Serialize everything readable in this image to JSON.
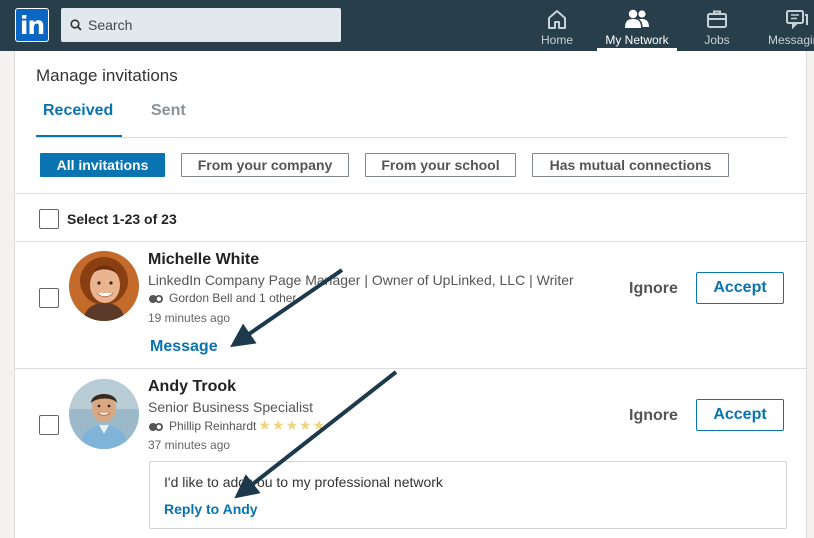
{
  "topbar": {
    "logo_text": "in",
    "search": {
      "placeholder": "Search"
    },
    "nav": [
      {
        "label": "Home",
        "icon": "home-icon",
        "active": false
      },
      {
        "label": "My Network",
        "icon": "people-icon",
        "active": true
      },
      {
        "label": "Jobs",
        "icon": "briefcase-icon",
        "active": false
      },
      {
        "label": "Messaging",
        "icon": "messaging-icon",
        "active": false
      }
    ]
  },
  "page": {
    "title": "Manage invitations",
    "tabs": [
      {
        "label": "Received",
        "active": true
      },
      {
        "label": "Sent",
        "active": false
      }
    ],
    "filters": [
      {
        "label": "All invitations",
        "active": true
      },
      {
        "label": "From your company",
        "active": false
      },
      {
        "label": "From your school",
        "active": false
      },
      {
        "label": "Has mutual connections",
        "active": false
      }
    ],
    "select_label": "Select 1-23 of 23"
  },
  "invitations": [
    {
      "name": "Michelle White",
      "headline": "LinkedIn Company Page Manager | Owner of UpLinked, LLC | Writer",
      "mutual": "Gordon Bell and 1 other",
      "time": "19 minutes ago",
      "message_link": "Message",
      "ignore_label": "Ignore",
      "accept_label": "Accept"
    },
    {
      "name": "Andy Trook",
      "headline": "Senior Business Specialist",
      "mutual": "Phillip Reinhardt",
      "stars": "★★★★★",
      "time": "37 minutes ago",
      "note": "I'd like to add you to my professional network",
      "reply_link": "Reply to Andy",
      "ignore_label": "Ignore",
      "accept_label": "Accept"
    }
  ],
  "colors": {
    "nav_bg": "#283e4a",
    "brand_blue": "#0a73b1",
    "annotation_arrow": "#1d3a4d"
  }
}
